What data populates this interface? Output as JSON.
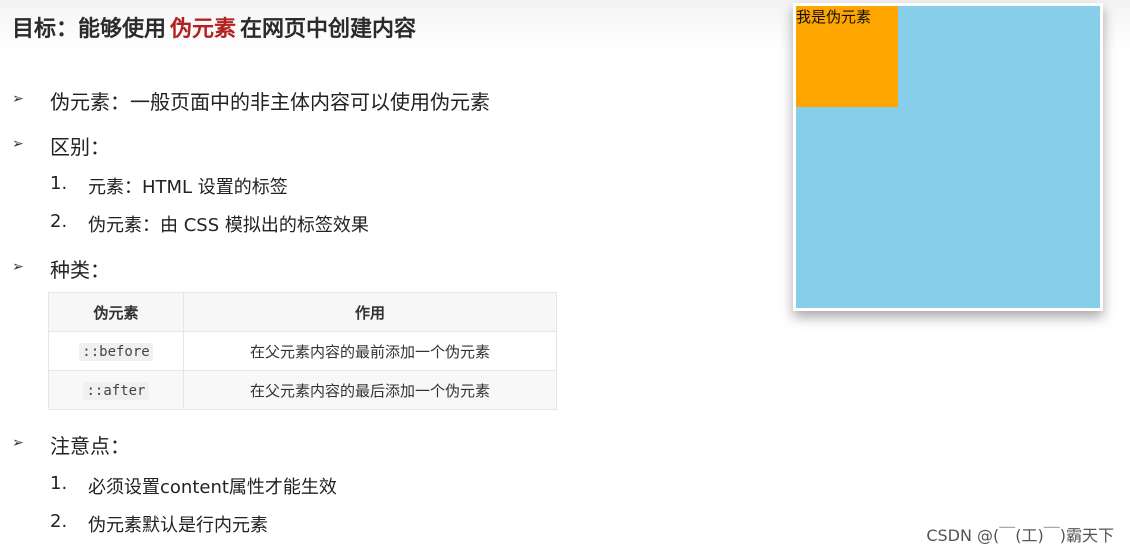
{
  "title": {
    "prefix": "目标：能够使用",
    "highlight": "伪元素",
    "suffix": "在网页中创建内容"
  },
  "bullet_icon": "arrowhead-bullet-icon",
  "items": {
    "definition": "伪元素：一般页面中的非主体内容可以使用伪元素",
    "difference": {
      "label": "区别：",
      "points": [
        {
          "num": "1.",
          "text": "元素：HTML 设置的标签"
        },
        {
          "num": "2.",
          "text": "伪元素：由 CSS 模拟出的标签效果"
        }
      ]
    },
    "types": {
      "label": "种类：",
      "table": {
        "headers": [
          "伪元素",
          "作用"
        ],
        "rows": [
          {
            "name": "::before",
            "effect": "在父元素内容的最前添加一个伪元素"
          },
          {
            "name": "::after",
            "effect": "在父元素内容的最后添加一个伪元素"
          }
        ]
      }
    },
    "notes": {
      "label": "注意点：",
      "points": [
        {
          "num": "1.",
          "text": "必须设置content属性才能生效"
        },
        {
          "num": "2.",
          "text": "伪元素默认是行内元素"
        }
      ]
    }
  },
  "demo": {
    "before_text": "我是伪元素",
    "box_color": "#87ceeb",
    "before_color": "#ffa500"
  },
  "watermark": "CSDN @(￣(工)￣)霸天下",
  "colors": {
    "highlight": "#b22222"
  }
}
